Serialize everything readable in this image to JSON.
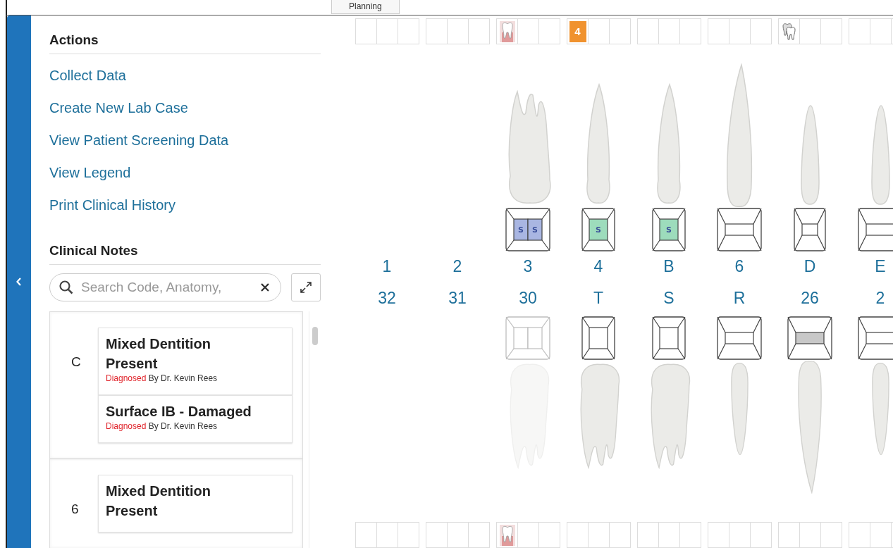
{
  "top_tab": {
    "label": "Planning"
  },
  "actions": {
    "title": "Actions",
    "links": [
      "Collect Data",
      "Create New Lab Case",
      "View Patient Screening Data",
      "View Legend",
      "Print Clinical History"
    ]
  },
  "clinical_notes": {
    "title": "Clinical Notes",
    "search": {
      "placeholder": "Search Code, Anatomy,"
    },
    "groups": [
      {
        "tooth": "C",
        "notes": [
          {
            "title": "Mixed Dentition Present",
            "status": "Diagnosed",
            "by": "By Dr. Kevin Rees"
          },
          {
            "title": "Surface IB - Damaged",
            "status": "Diagnosed",
            "by": "By Dr. Kevin Rees"
          }
        ]
      },
      {
        "tooth": "6",
        "notes": [
          {
            "title": "Mixed Dentition Present"
          }
        ]
      }
    ]
  },
  "chart": {
    "columns": [
      {
        "top_flags": [
          {
            "kind": "empty"
          },
          {
            "kind": "empty"
          },
          {
            "kind": "empty"
          }
        ],
        "upper": {
          "label": "1"
        },
        "lower": {
          "label": "32"
        },
        "bottom_flags": [
          {
            "kind": "empty"
          },
          {
            "kind": "empty"
          },
          {
            "kind": "empty"
          }
        ]
      },
      {
        "top_flags": [
          {
            "kind": "empty"
          },
          {
            "kind": "empty"
          },
          {
            "kind": "empty"
          }
        ],
        "upper": {
          "label": "2"
        },
        "lower": {
          "label": "31"
        },
        "bottom_flags": [
          {
            "kind": "empty"
          },
          {
            "kind": "empty"
          },
          {
            "kind": "empty"
          }
        ]
      },
      {
        "top_flags": [
          {
            "kind": "tooth"
          },
          {
            "kind": "empty"
          },
          {
            "kind": "empty"
          }
        ],
        "upper": {
          "label": "3",
          "tooth": {
            "kind": "molar",
            "faded": false
          },
          "surface": {
            "kind": "molar",
            "faded": false,
            "fills": [
              {
                "text": "S",
                "color": "#a9b6e2"
              },
              {
                "text": "S",
                "color": "#a9b6e2"
              }
            ]
          }
        },
        "lower": {
          "label": "30",
          "tooth": {
            "kind": "molar",
            "faded": true
          },
          "surface": {
            "kind": "molar",
            "faded": true
          }
        },
        "bottom_flags": [
          {
            "kind": "tooth"
          },
          {
            "kind": "empty"
          },
          {
            "kind": "empty"
          }
        ]
      },
      {
        "top_flags": [
          {
            "kind": "badge",
            "text": "4"
          },
          {
            "kind": "empty"
          },
          {
            "kind": "empty"
          }
        ],
        "upper": {
          "label": "4",
          "tooth": {
            "kind": "premolar",
            "faded": false
          },
          "surface": {
            "kind": "premolar",
            "faded": false,
            "fills": [
              {
                "text": "S",
                "color": "#9ddcbc"
              }
            ]
          }
        },
        "lower": {
          "label": "T",
          "tooth": {
            "kind": "molar",
            "faded": false
          },
          "surface": {
            "kind": "premolar",
            "faded": false
          }
        },
        "bottom_flags": [
          {
            "kind": "empty"
          },
          {
            "kind": "empty"
          },
          {
            "kind": "empty"
          }
        ]
      },
      {
        "top_flags": [
          {
            "kind": "empty"
          },
          {
            "kind": "empty"
          },
          {
            "kind": "empty"
          }
        ],
        "upper": {
          "label": "B",
          "tooth": {
            "kind": "premolar",
            "faded": false
          },
          "surface": {
            "kind": "premolar",
            "faded": false,
            "fills": [
              {
                "text": "S",
                "color": "#9ddcbc"
              }
            ]
          }
        },
        "lower": {
          "label": "S",
          "tooth": {
            "kind": "molar",
            "faded": false
          },
          "surface": {
            "kind": "premolar",
            "faded": false
          }
        },
        "bottom_flags": [
          {
            "kind": "empty"
          },
          {
            "kind": "empty"
          },
          {
            "kind": "empty"
          }
        ]
      },
      {
        "top_flags": [
          {
            "kind": "empty"
          },
          {
            "kind": "empty"
          },
          {
            "kind": "empty"
          }
        ],
        "upper": {
          "label": "6",
          "tooth": {
            "kind": "canine",
            "faded": false
          },
          "surface": {
            "kind": "anterior",
            "faded": false
          }
        },
        "lower": {
          "label": "R",
          "tooth": {
            "kind": "incisor",
            "faded": false
          },
          "surface": {
            "kind": "anterior",
            "faded": false
          }
        },
        "bottom_flags": [
          {
            "kind": "empty"
          },
          {
            "kind": "empty"
          },
          {
            "kind": "empty"
          }
        ]
      },
      {
        "top_flags": [
          {
            "kind": "teeth"
          },
          {
            "kind": "empty"
          },
          {
            "kind": "empty"
          }
        ],
        "upper": {
          "label": "D",
          "tooth": {
            "kind": "incisor",
            "faded": false
          },
          "surface": {
            "kind": "narrow",
            "faded": false
          }
        },
        "lower": {
          "label": "26",
          "tooth": {
            "kind": "canine",
            "faded": false
          },
          "surface": {
            "kind": "anterior",
            "faded": false,
            "fills": [
              {
                "color": "#c8c8c8"
              }
            ]
          }
        },
        "bottom_flags": [
          {
            "kind": "empty"
          },
          {
            "kind": "empty"
          },
          {
            "kind": "empty"
          }
        ]
      },
      {
        "top_flags": [
          {
            "kind": "empty"
          },
          {
            "kind": "empty"
          },
          {
            "kind": "empty"
          }
        ],
        "upper": {
          "label": "E",
          "tooth": {
            "kind": "incisor",
            "faded": false
          },
          "surface": {
            "kind": "anterior",
            "faded": false
          }
        },
        "lower": {
          "label": "2",
          "tooth": {
            "kind": "incisor",
            "faded": false
          },
          "surface": {
            "kind": "anterior",
            "faded": false
          }
        },
        "bottom_flags": [
          {
            "kind": "empty"
          },
          {
            "kind": "empty"
          },
          {
            "kind": "empty"
          }
        ]
      }
    ]
  }
}
